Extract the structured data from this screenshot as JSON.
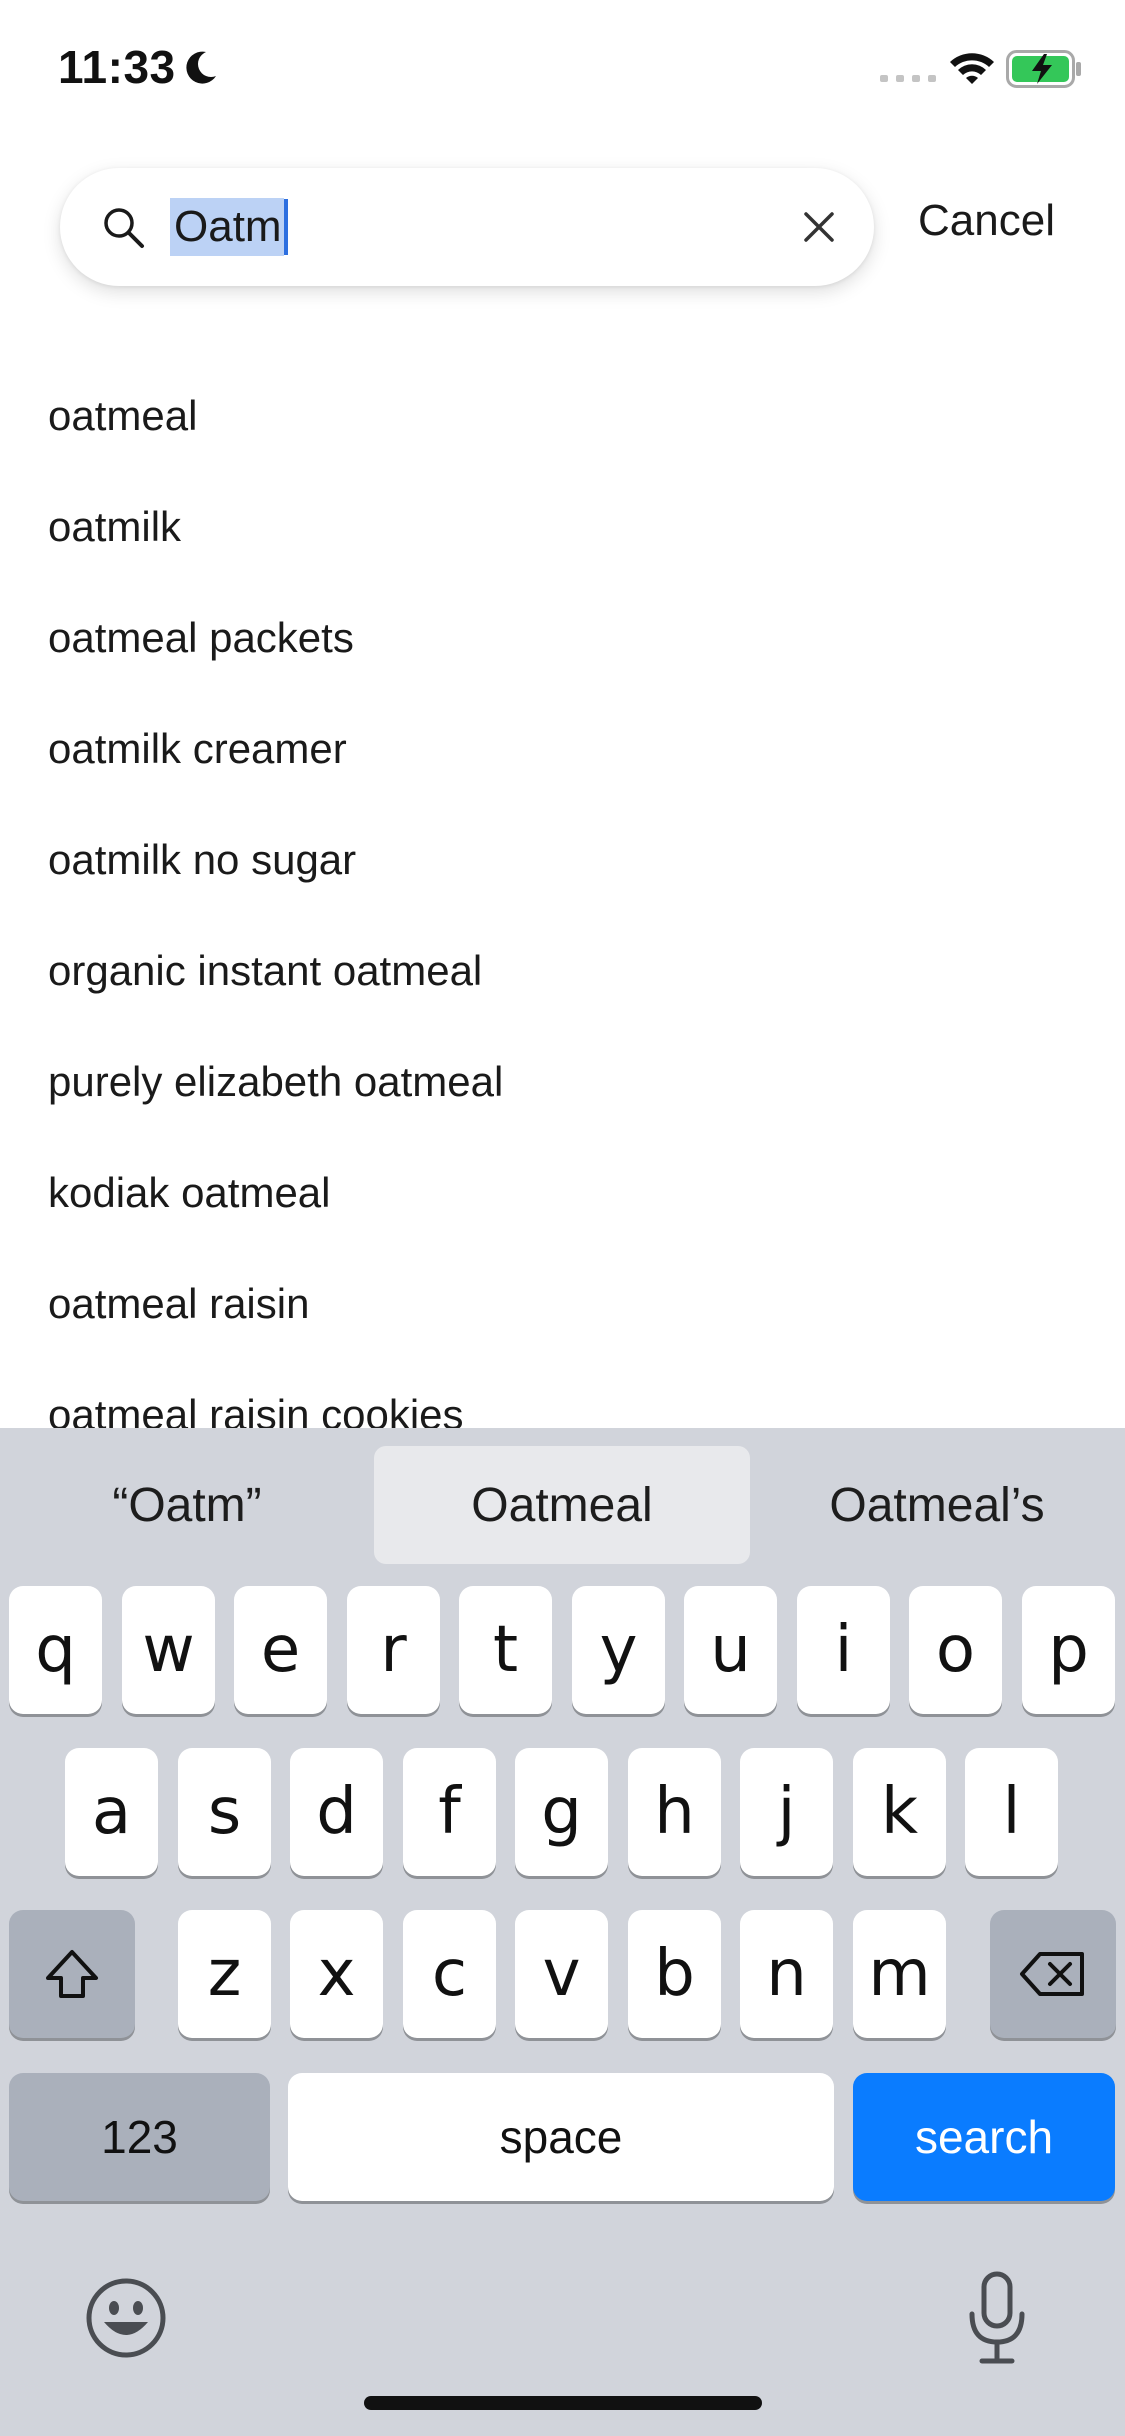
{
  "status_bar": {
    "time": "11:33",
    "icons": [
      "moon-icon",
      "cellular-signal-icon",
      "wifi-icon",
      "battery-charging-icon"
    ],
    "battery_color": "#34c759"
  },
  "search": {
    "query": "Oatm",
    "cancel_label": "Cancel",
    "icons": [
      "search-icon",
      "clear-icon"
    ]
  },
  "suggestions": [
    "oatmeal",
    "oatmilk",
    "oatmeal packets",
    "oatmilk creamer",
    "oatmilk no sugar",
    "organic instant oatmeal",
    "purely elizabeth oatmeal",
    "kodiak oatmeal",
    "oatmeal raisin",
    "oatmeal raisin cookies"
  ],
  "keyboard": {
    "predictions": [
      "“Oatm”",
      "Oatmeal",
      "Oatmeal’s"
    ],
    "row1": [
      "q",
      "w",
      "e",
      "r",
      "t",
      "y",
      "u",
      "i",
      "o",
      "p"
    ],
    "row2": [
      "a",
      "s",
      "d",
      "f",
      "g",
      "h",
      "j",
      "k",
      "l"
    ],
    "row3": [
      "z",
      "x",
      "c",
      "v",
      "b",
      "n",
      "m"
    ],
    "numbers_label": "123",
    "space_label": "space",
    "search_label": "search",
    "accent_color": "#0a7cff",
    "icons": [
      "shift-icon",
      "backspace-icon",
      "emoji-icon",
      "microphone-icon"
    ]
  }
}
